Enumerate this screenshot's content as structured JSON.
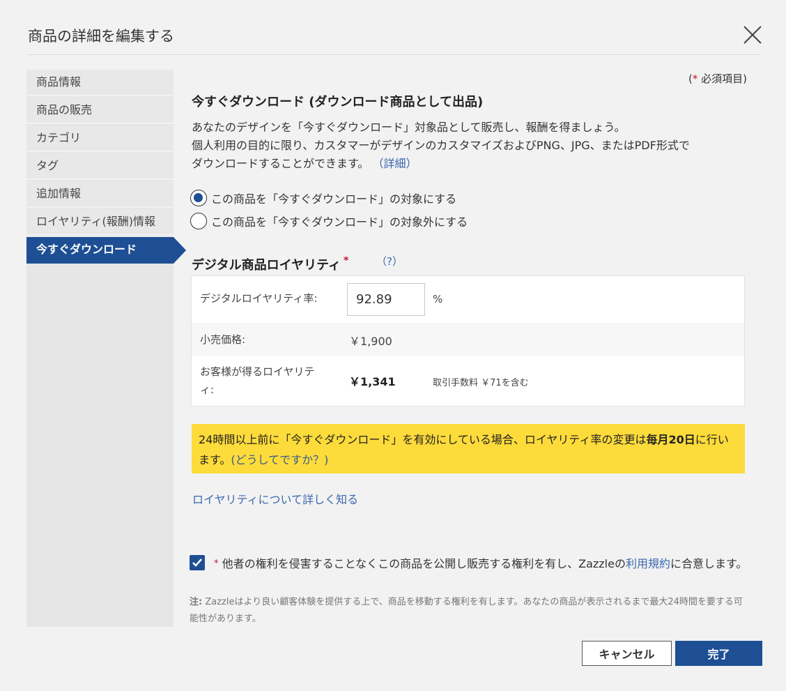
{
  "dialog": {
    "title": "商品の詳細を編集する"
  },
  "sidebar": {
    "items": [
      {
        "label": "商品情報"
      },
      {
        "label": "商品の販売"
      },
      {
        "label": "カテゴリ"
      },
      {
        "label": "タグ"
      },
      {
        "label": "追加情報"
      },
      {
        "label": "ロイヤリティ(報酬)情報"
      },
      {
        "label": "今すぐダウンロード"
      }
    ],
    "active_index": 6
  },
  "required_note": {
    "open": "(",
    "star": "*",
    "text": "必須項目)"
  },
  "instant": {
    "heading": "今すぐダウンロード (ダウンロード商品として出品)",
    "desc_line1": "あなたのデザインを「今すぐダウンロード」対象品として販売し、報酬を得ましょう。",
    "desc_line2": "個人利用の目的に限り、カスタマーがデザインのカスタマイズおよびPNG、JPG、またはPDF形式で",
    "desc_line3": "ダウンロードすることができます。",
    "details_link": "（詳細）",
    "radio_enable": "この商品を「今すぐダウンロード」の対象にする",
    "radio_disable": "この商品を「今すぐダウンロード」の対象外にする",
    "selected": "enable"
  },
  "royalty": {
    "heading": "デジタル商品ロイヤリティ",
    "star": "*",
    "help_link": "（?）",
    "rate_label": "デジタルロイヤリティ率:",
    "rate_value": "92.89",
    "rate_unit": "%",
    "price_label": "小売価格:",
    "price_value": "￥1,900",
    "earn_label_line1": "お客様が得るロイヤリテ",
    "earn_label_line2": "ィ:",
    "earn_value": "￥1,341",
    "fee_note": "取引手数料 ￥71を含む"
  },
  "notice": {
    "text_before": "24時間以上前に「今すぐダウンロード」を有効にしている場合、ロイヤリティ率の変更は",
    "bold": "毎月20日",
    "text_after": "に行います。",
    "link": "(どうしてですか？)"
  },
  "learn_link": "ロイヤリティについて詳しく知る",
  "agreement": {
    "checked": true,
    "star": "*",
    "text_before": "他者の権利を侵害することなくこの商品を公開し販売する権利を有し、Zazzleの",
    "terms_link": "利用規約",
    "text_after": "に合意します。"
  },
  "note": {
    "label": "注:",
    "text": "Zazzleはより良い顧客体験を提供する上で、商品を移動する権利を有します。あなたの商品が表示されるまで最大24時間を要する可能性があります。"
  },
  "buttons": {
    "cancel": "キャンセル",
    "done": "完了"
  },
  "colors": {
    "accent": "#1e4f94",
    "notice_bg": "#fddb3a",
    "required": "#c8102e",
    "link": "#3a67ad"
  }
}
